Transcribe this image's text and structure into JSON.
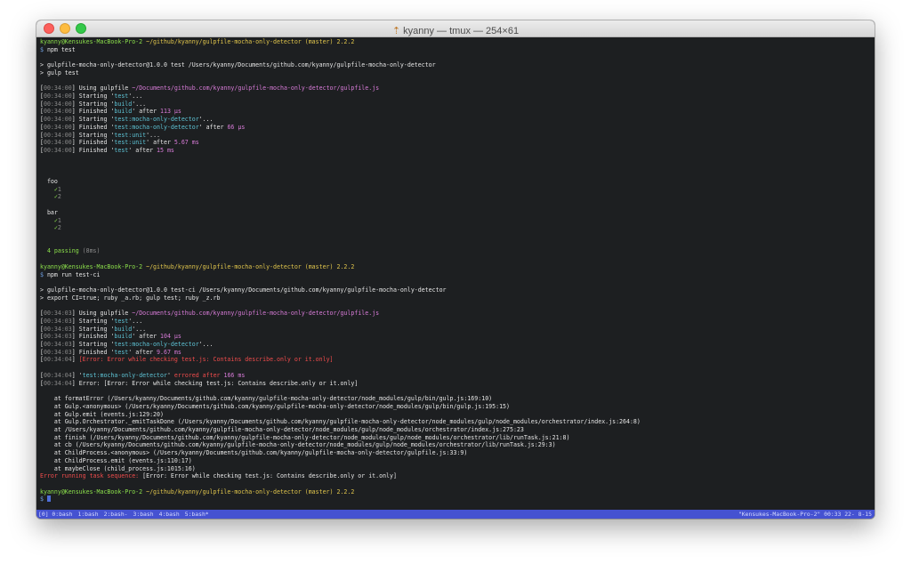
{
  "window": {
    "title": "kyanny — tmux — 254×61",
    "title_icon": "⇡"
  },
  "terminal_lines": [
    [
      {
        "t": "kyanny@Kensukes-MacBook-Pro-2 ",
        "c": "g"
      },
      {
        "t": "~/github/kyanny/gulpfile-mocha-only-detector ",
        "c": "y"
      },
      {
        "t": "(master) 2.2.2",
        "c": "y"
      }
    ],
    [
      {
        "t": "$ ",
        "c": "b"
      },
      {
        "t": "npm test",
        "c": "w"
      }
    ],
    [],
    [
      {
        "t": "> gulpfile-mocha-only-detector@1.0.0 test /Users/kyanny/Documents/github.com/kyanny/gulpfile-mocha-only-detector",
        "c": "w"
      }
    ],
    [
      {
        "t": "> gulp test",
        "c": "w"
      }
    ],
    [],
    [
      {
        "t": "[",
        "c": "w"
      },
      {
        "t": "00:34:00",
        "c": "gr"
      },
      {
        "t": "] Using gulpfile ",
        "c": "w"
      },
      {
        "t": "~/Documents/github.com/kyanny/gulpfile-mocha-only-detector/gulpfile.js",
        "c": "m"
      }
    ],
    [
      {
        "t": "[",
        "c": "w"
      },
      {
        "t": "00:34:00",
        "c": "gr"
      },
      {
        "t": "] Starting '",
        "c": "w"
      },
      {
        "t": "test",
        "c": "c"
      },
      {
        "t": "'...",
        "c": "w"
      }
    ],
    [
      {
        "t": "[",
        "c": "w"
      },
      {
        "t": "00:34:00",
        "c": "gr"
      },
      {
        "t": "] Starting '",
        "c": "w"
      },
      {
        "t": "build",
        "c": "c"
      },
      {
        "t": "'...",
        "c": "w"
      }
    ],
    [
      {
        "t": "[",
        "c": "w"
      },
      {
        "t": "00:34:00",
        "c": "gr"
      },
      {
        "t": "] Finished '",
        "c": "w"
      },
      {
        "t": "build",
        "c": "c"
      },
      {
        "t": "' after ",
        "c": "w"
      },
      {
        "t": "113 μs",
        "c": "m"
      }
    ],
    [
      {
        "t": "[",
        "c": "w"
      },
      {
        "t": "00:34:00",
        "c": "gr"
      },
      {
        "t": "] Starting '",
        "c": "w"
      },
      {
        "t": "test:mocha-only-detector",
        "c": "c"
      },
      {
        "t": "'...",
        "c": "w"
      }
    ],
    [
      {
        "t": "[",
        "c": "w"
      },
      {
        "t": "00:34:00",
        "c": "gr"
      },
      {
        "t": "] Finished '",
        "c": "w"
      },
      {
        "t": "test:mocha-only-detector",
        "c": "c"
      },
      {
        "t": "' after ",
        "c": "w"
      },
      {
        "t": "66 μs",
        "c": "m"
      }
    ],
    [
      {
        "t": "[",
        "c": "w"
      },
      {
        "t": "00:34:00",
        "c": "gr"
      },
      {
        "t": "] Starting '",
        "c": "w"
      },
      {
        "t": "test:unit",
        "c": "c"
      },
      {
        "t": "'...",
        "c": "w"
      }
    ],
    [
      {
        "t": "[",
        "c": "w"
      },
      {
        "t": "00:34:00",
        "c": "gr"
      },
      {
        "t": "] Finished '",
        "c": "w"
      },
      {
        "t": "test:unit",
        "c": "c"
      },
      {
        "t": "' after ",
        "c": "w"
      },
      {
        "t": "5.67 ms",
        "c": "m"
      }
    ],
    [
      {
        "t": "[",
        "c": "w"
      },
      {
        "t": "00:34:00",
        "c": "gr"
      },
      {
        "t": "] Finished '",
        "c": "w"
      },
      {
        "t": "test",
        "c": "c"
      },
      {
        "t": "' after ",
        "c": "w"
      },
      {
        "t": "15 ms",
        "c": "m"
      }
    ],
    [],
    [],
    [],
    [
      {
        "t": "  foo",
        "c": "w"
      }
    ],
    [
      {
        "t": "    ✓",
        "c": "g"
      },
      {
        "t": "1",
        "c": "gr"
      }
    ],
    [
      {
        "t": "    ✓",
        "c": "g"
      },
      {
        "t": "2",
        "c": "gr"
      }
    ],
    [],
    [
      {
        "t": "  bar",
        "c": "w"
      }
    ],
    [
      {
        "t": "    ✓",
        "c": "g"
      },
      {
        "t": "1",
        "c": "gr"
      }
    ],
    [
      {
        "t": "    ✓",
        "c": "g"
      },
      {
        "t": "2",
        "c": "gr"
      }
    ],
    [],
    [],
    [
      {
        "t": "  4 passing ",
        "c": "g"
      },
      {
        "t": "(8ms)",
        "c": "gr"
      }
    ],
    [],
    [
      {
        "t": "kyanny@Kensukes-MacBook-Pro-2 ",
        "c": "g"
      },
      {
        "t": "~/github/kyanny/gulpfile-mocha-only-detector ",
        "c": "y"
      },
      {
        "t": "(master) 2.2.2",
        "c": "y"
      }
    ],
    [
      {
        "t": "$ ",
        "c": "b"
      },
      {
        "t": "npm run test-ci",
        "c": "w"
      }
    ],
    [],
    [
      {
        "t": "> gulpfile-mocha-only-detector@1.0.0 test-ci /Users/kyanny/Documents/github.com/kyanny/gulpfile-mocha-only-detector",
        "c": "w"
      }
    ],
    [
      {
        "t": "> export CI=true; ruby _a.rb; gulp test; ruby _z.rb",
        "c": "w"
      }
    ],
    [],
    [
      {
        "t": "[",
        "c": "w"
      },
      {
        "t": "00:34:03",
        "c": "gr"
      },
      {
        "t": "] Using gulpfile ",
        "c": "w"
      },
      {
        "t": "~/Documents/github.com/kyanny/gulpfile-mocha-only-detector/gulpfile.js",
        "c": "m"
      }
    ],
    [
      {
        "t": "[",
        "c": "w"
      },
      {
        "t": "00:34:03",
        "c": "gr"
      },
      {
        "t": "] Starting '",
        "c": "w"
      },
      {
        "t": "test",
        "c": "c"
      },
      {
        "t": "'...",
        "c": "w"
      }
    ],
    [
      {
        "t": "[",
        "c": "w"
      },
      {
        "t": "00:34:03",
        "c": "gr"
      },
      {
        "t": "] Starting '",
        "c": "w"
      },
      {
        "t": "build",
        "c": "c"
      },
      {
        "t": "'...",
        "c": "w"
      }
    ],
    [
      {
        "t": "[",
        "c": "w"
      },
      {
        "t": "00:34:03",
        "c": "gr"
      },
      {
        "t": "] Finished '",
        "c": "w"
      },
      {
        "t": "build",
        "c": "c"
      },
      {
        "t": "' after ",
        "c": "w"
      },
      {
        "t": "104 μs",
        "c": "m"
      }
    ],
    [
      {
        "t": "[",
        "c": "w"
      },
      {
        "t": "00:34:03",
        "c": "gr"
      },
      {
        "t": "] Starting '",
        "c": "w"
      },
      {
        "t": "test:mocha-only-detector",
        "c": "c"
      },
      {
        "t": "'...",
        "c": "w"
      }
    ],
    [
      {
        "t": "[",
        "c": "w"
      },
      {
        "t": "00:34:03",
        "c": "gr"
      },
      {
        "t": "] Finished '",
        "c": "w"
      },
      {
        "t": "test",
        "c": "c"
      },
      {
        "t": "' after ",
        "c": "w"
      },
      {
        "t": "9.67 ms",
        "c": "m"
      }
    ],
    [
      {
        "t": "[",
        "c": "w"
      },
      {
        "t": "00:34:04",
        "c": "gr"
      },
      {
        "t": "] ",
        "c": "w"
      },
      {
        "t": "[Error: Error while checking test.js: Contains describe.only or it.only]",
        "c": "r"
      }
    ],
    [],
    [
      {
        "t": "[",
        "c": "w"
      },
      {
        "t": "00:34:04",
        "c": "gr"
      },
      {
        "t": "] '",
        "c": "w"
      },
      {
        "t": "test:mocha-only-detector",
        "c": "c"
      },
      {
        "t": "' ",
        "c": "w"
      },
      {
        "t": "errored after",
        "c": "r"
      },
      {
        "t": " 166 ms",
        "c": "m"
      }
    ],
    [
      {
        "t": "[",
        "c": "w"
      },
      {
        "t": "00:34:04",
        "c": "gr"
      },
      {
        "t": "] Error: [Error: Error while checking test.js: Contains describe.only or it.only]",
        "c": "w"
      }
    ],
    [],
    [
      {
        "t": "    at formatError (/Users/kyanny/Documents/github.com/kyanny/gulpfile-mocha-only-detector/node_modules/gulp/bin/gulp.js:169:10)",
        "c": "w"
      }
    ],
    [
      {
        "t": "    at Gulp.<anonymous> (/Users/kyanny/Documents/github.com/kyanny/gulpfile-mocha-only-detector/node_modules/gulp/bin/gulp.js:195:15)",
        "c": "w"
      }
    ],
    [
      {
        "t": "    at Gulp.emit (events.js:129:20)",
        "c": "w"
      }
    ],
    [
      {
        "t": "    at Gulp.Orchestrator._emitTaskDone (/Users/kyanny/Documents/github.com/kyanny/gulpfile-mocha-only-detector/node_modules/gulp/node_modules/orchestrator/index.js:264:8)",
        "c": "w"
      }
    ],
    [
      {
        "t": "    at /Users/kyanny/Documents/github.com/kyanny/gulpfile-mocha-only-detector/node_modules/gulp/node_modules/orchestrator/index.js:275:23",
        "c": "w"
      }
    ],
    [
      {
        "t": "    at finish (/Users/kyanny/Documents/github.com/kyanny/gulpfile-mocha-only-detector/node_modules/gulp/node_modules/orchestrator/lib/runTask.js:21:8)",
        "c": "w"
      }
    ],
    [
      {
        "t": "    at cb (/Users/kyanny/Documents/github.com/kyanny/gulpfile-mocha-only-detector/node_modules/gulp/node_modules/orchestrator/lib/runTask.js:29:3)",
        "c": "w"
      }
    ],
    [
      {
        "t": "    at ChildProcess.<anonymous> (/Users/kyanny/Documents/github.com/kyanny/gulpfile-mocha-only-detector/gulpfile.js:33:9)",
        "c": "w"
      }
    ],
    [
      {
        "t": "    at ChildProcess.emit (events.js:110:17)",
        "c": "w"
      }
    ],
    [
      {
        "t": "    at maybeClose (child_process.js:1015:16)",
        "c": "w"
      }
    ],
    [
      {
        "t": "Error running task sequence: ",
        "c": "r"
      },
      {
        "t": "[Error: Error while checking test.js: Contains describe.only or it.only]",
        "c": "w"
      }
    ],
    [],
    [
      {
        "t": "kyanny@Kensukes-MacBook-Pro-2 ",
        "c": "g"
      },
      {
        "t": "~/github/kyanny/gulpfile-mocha-only-detector ",
        "c": "y"
      },
      {
        "t": "(master) 2.2.2",
        "c": "y"
      }
    ],
    [
      {
        "t": "$ ",
        "c": "b"
      },
      {
        "t": "",
        "c": "cursor"
      }
    ]
  ],
  "statusbar": {
    "windows": [
      "[0] 0:bash",
      "1:bash",
      "2:bash-",
      "3:bash",
      "4:bash",
      "5:bash*"
    ],
    "right": "\"Kensukes-MacBook-Pro-2\" 00:33 22- 8-15"
  },
  "colors": {
    "terminal_bg": "#1d1f21",
    "status_bg": "#4552d1",
    "prompt_user": "#8ce04b",
    "prompt_path": "#e0c54c",
    "task_name": "#5ec4d6",
    "duration": "#d87bd8",
    "error": "#f04c4c"
  },
  "icons": {
    "window_title": "arrow-up-icon"
  }
}
